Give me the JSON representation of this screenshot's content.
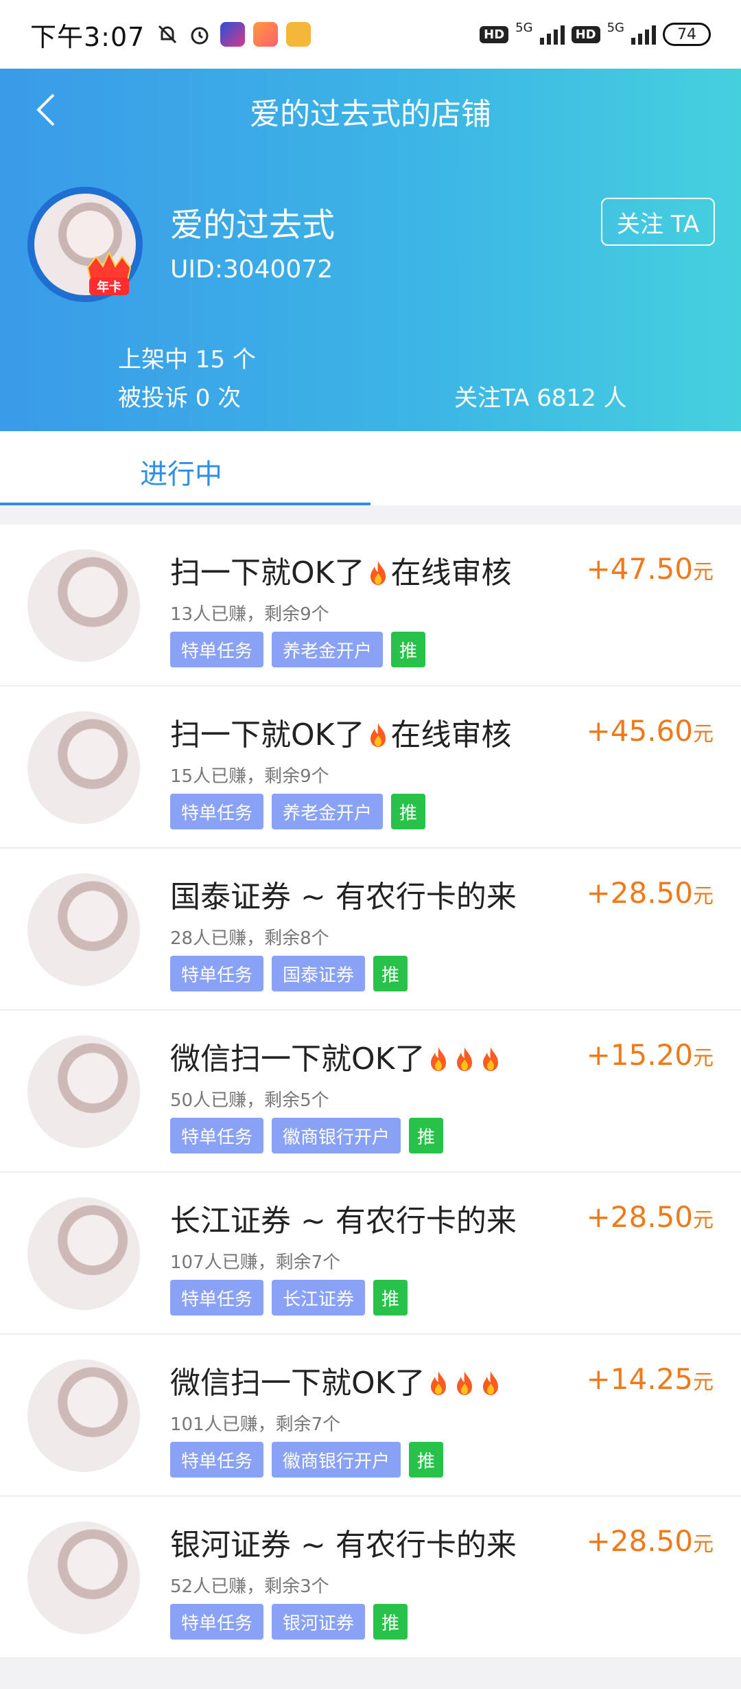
{
  "status": {
    "time": "下午3:07",
    "battery": "74",
    "hd1": "HD",
    "hd2": "HD",
    "net1": "5G",
    "net2": "5G"
  },
  "nav": {
    "title": "爱的过去式的店铺"
  },
  "shop": {
    "name": "爱的过去式",
    "uid": "UID:3040072",
    "badge": "年卡",
    "follow_button": "关注 TA",
    "listed": "上架中 15 个",
    "complaints": "被投诉 0 次",
    "followers": "关注TA 6812 人"
  },
  "tabs": [
    {
      "label": "进行中"
    }
  ],
  "tasks": [
    {
      "title": "扫一下就OK了",
      "title_suffix": "在线审核",
      "fires": 1,
      "meta": "13人已赚，剩余9个",
      "tags": [
        "特单任务",
        "养老金开户"
      ],
      "push": "推",
      "price": "+47.50",
      "unit": "元"
    },
    {
      "title": "扫一下就OK了",
      "title_suffix": "在线审核",
      "fires": 1,
      "meta": "15人已赚，剩余9个",
      "tags": [
        "特单任务",
        "养老金开户"
      ],
      "push": "推",
      "price": "+45.60",
      "unit": "元"
    },
    {
      "title": "国泰证券 ~ 有农行卡的来",
      "title_suffix": "",
      "fires": 0,
      "meta": "28人已赚，剩余8个",
      "tags": [
        "特单任务",
        "国泰证券"
      ],
      "push": "推",
      "price": "+28.50",
      "unit": "元"
    },
    {
      "title": "微信扫一下就OK了",
      "title_suffix": "",
      "fires": 3,
      "meta": "50人已赚，剩余5个",
      "tags": [
        "特单任务",
        "徽商银行开户"
      ],
      "push": "推",
      "price": "+15.20",
      "unit": "元"
    },
    {
      "title": "长江证券 ~ 有农行卡的来",
      "title_suffix": "",
      "fires": 0,
      "meta": "107人已赚，剩余7个",
      "tags": [
        "特单任务",
        "长江证券"
      ],
      "push": "推",
      "price": "+28.50",
      "unit": "元"
    },
    {
      "title": "微信扫一下就OK了",
      "title_suffix": "",
      "fires": 3,
      "meta": "101人已赚，剩余7个",
      "tags": [
        "特单任务",
        "徽商银行开户"
      ],
      "push": "推",
      "price": "+14.25",
      "unit": "元"
    },
    {
      "title": "银河证券 ~ 有农行卡的来",
      "title_suffix": "",
      "fires": 0,
      "meta": "52人已赚，剩余3个",
      "tags": [
        "特单任务",
        "银河证券"
      ],
      "push": "推",
      "price": "+28.50",
      "unit": "元"
    }
  ],
  "colors": {
    "accent": "#2f8ee8",
    "price": "#f07a1a",
    "tag": "#8aa2f6",
    "push": "#28c24a"
  }
}
